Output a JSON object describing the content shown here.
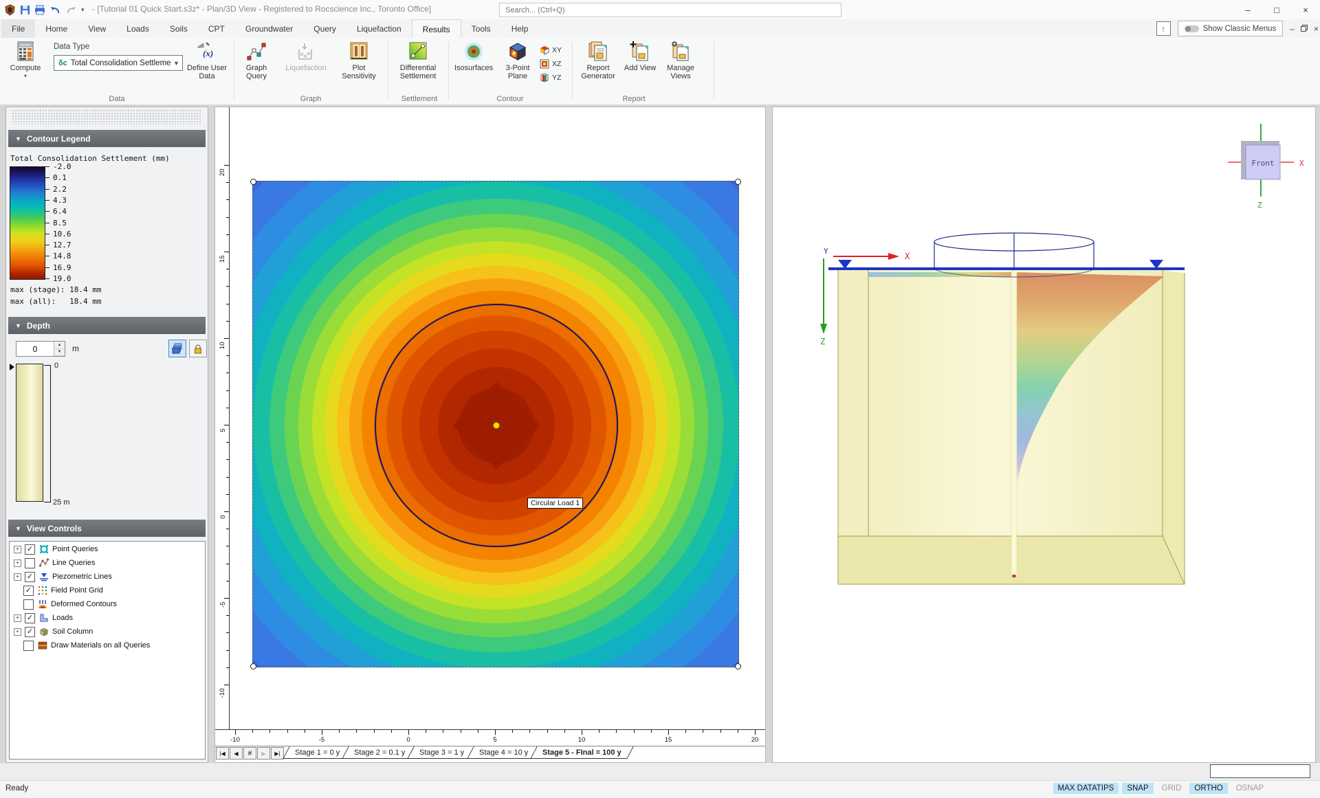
{
  "titlebar": {
    "title": "- [Tutorial 01 Quick Start.s3z* - Plan/3D View - Registered to Rocscience Inc., Toronto Office]",
    "search_placeholder": "Search... (Ctrl+Q)",
    "window_minimize": "–",
    "window_maximize": "□",
    "window_close": "×"
  },
  "menu": {
    "tabs": [
      {
        "label": "File"
      },
      {
        "label": "Home"
      },
      {
        "label": "View"
      },
      {
        "label": "Loads"
      },
      {
        "label": "Soils"
      },
      {
        "label": "CPT"
      },
      {
        "label": "Groundwater"
      },
      {
        "label": "Query"
      },
      {
        "label": "Liquefaction"
      },
      {
        "label": "Results",
        "active": true
      },
      {
        "label": "Tools"
      },
      {
        "label": "Help"
      }
    ],
    "show_classic_menus": "Show Classic Menus",
    "collapse_ribbon_glyph": "↑",
    "mdi_minimize": "–",
    "mdi_close": "×"
  },
  "ribbon": {
    "compute_label": "Compute",
    "data_type_label": "Data Type",
    "data_type_symbol": "δc",
    "data_type_value": "Total Consolidation Settlement",
    "define_user_data": "Define User Data",
    "graph_query": "Graph Query",
    "liquefaction": "Liquefaction",
    "plot_sensitivity": "Plot Sensitivity",
    "differential_settlement": "Differential Settlement",
    "isosurfaces": "Isosurfaces",
    "three_point_plane": "3-Point Plane",
    "plane_xy": "XY",
    "plane_xz": "XZ",
    "plane_yz": "YZ",
    "report_generator": "Report Generator",
    "add_view": "Add View",
    "manage_views": "Manage Views",
    "groups": {
      "data": "Data",
      "graph": "Graph",
      "settlement": "Settlement",
      "contour": "Contour",
      "report": "Report"
    }
  },
  "legend": {
    "header": "Contour Legend",
    "title": "Total Consolidation Settlement (mm)",
    "ticks": [
      "-2.0",
      "0.1",
      "2.2",
      "4.3",
      "6.4",
      "8.5",
      "10.6",
      "12.7",
      "14.8",
      "16.9",
      "19.0"
    ],
    "max_stage": "max (stage): 18.4 mm",
    "max_all": "max (all):   18.4 mm"
  },
  "depth": {
    "header": "Depth",
    "value": "0",
    "unit": "m",
    "scale_top": "0",
    "scale_bottom": "25 m"
  },
  "view_controls": {
    "header": "View Controls",
    "items": [
      {
        "label": "Point Queries",
        "checked": true,
        "expandable": true,
        "icon": "point-queries-icon"
      },
      {
        "label": "Line Queries",
        "checked": false,
        "expandable": true,
        "icon": "line-queries-icon"
      },
      {
        "label": "Piezometric Lines",
        "checked": true,
        "expandable": true,
        "icon": "piezometric-lines-icon"
      },
      {
        "label": "Field Point Grid",
        "checked": true,
        "expandable": false,
        "icon": "field-point-grid-icon"
      },
      {
        "label": "Deformed Contours",
        "checked": false,
        "expandable": false,
        "icon": "deformed-contours-icon"
      },
      {
        "label": "Loads",
        "checked": true,
        "expandable": true,
        "icon": "loads-icon"
      },
      {
        "label": "Soil Column",
        "checked": true,
        "expandable": true,
        "icon": "soil-column-icon"
      },
      {
        "label": "Draw Materials on all Queries",
        "checked": false,
        "expandable": false,
        "icon": "draw-materials-icon"
      }
    ]
  },
  "plan_view": {
    "x_ticks": [
      "-10",
      "-5",
      "0",
      "5",
      "10",
      "15",
      "20"
    ],
    "y_ticks": [
      "20",
      "15",
      "10",
      "5",
      "0",
      "-5",
      "-10"
    ],
    "load_label": "Circular Load 1"
  },
  "stages": {
    "tabs": [
      {
        "label": "Stage 1 = 0 y"
      },
      {
        "label": "Stage 2 = 0.1 y"
      },
      {
        "label": "Stage 3 = 1 y"
      },
      {
        "label": "Stage 4 = 10 y"
      },
      {
        "label": "Stage 5 - FInal = 100 y",
        "active": true
      }
    ]
  },
  "view3d": {
    "axis_x": "X",
    "axis_y": "Y",
    "axis_z": "Z",
    "cube_label": "Front",
    "cube_axis_x": "X",
    "cube_axis_z": "Z"
  },
  "statusbar": {
    "ready": "Ready",
    "toggles": [
      {
        "label": "MAX DATATIPS",
        "on": true
      },
      {
        "label": "SNAP",
        "on": true
      },
      {
        "label": "GRID",
        "on": false
      },
      {
        "label": "ORTHO",
        "on": true
      },
      {
        "label": "OSNAP",
        "on": false
      }
    ]
  },
  "colors": {
    "status_toggle_bg": "#bfe3f7",
    "panel_header": "#6b6f73",
    "load_center_dot": "#ffe000",
    "water_table": "#1b35c8",
    "soil_box": "#f6f2c6"
  }
}
